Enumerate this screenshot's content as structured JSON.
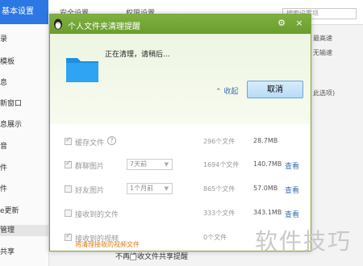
{
  "background": {
    "title": "基本设置",
    "tabs": [
      "安全设置",
      "权限设置"
    ],
    "search_placeholder": "搜索设置项",
    "sidebar": [
      "录",
      "模板",
      "息",
      "新窗口",
      "息展示",
      "音",
      "件",
      "件",
      "e更新",
      "管理",
      "共享"
    ],
    "right_texts": [
      "最高速",
      "无输速",
      "此选项)"
    ],
    "bottom_checkbox_label": "不再接收文件共享提醒"
  },
  "dialog": {
    "title": "个人文件夹清理提醒",
    "status_text": "正在清理，请稍后...",
    "collapse_label": "收起",
    "collapse_arrow": "⌃",
    "cancel_label": "取消",
    "rows": [
      {
        "label": "缓存文件",
        "checked": true,
        "help": "?",
        "select": "",
        "count": "296个文件",
        "size": "28.7MB",
        "view": ""
      },
      {
        "label": "群聊图片",
        "checked": true,
        "help": "",
        "select": "7天前",
        "count": "1694个文件",
        "size": "140.7MB",
        "view": "查看"
      },
      {
        "label": "好友图片",
        "checked": false,
        "help": "",
        "select": "1个月前",
        "count": "865个文件",
        "size": "57.0MB",
        "view": "查看"
      },
      {
        "label": "接收到的文件",
        "checked": false,
        "help": "",
        "select": "",
        "count": "333个文件",
        "size": "343.1MB",
        "view": "查看"
      },
      {
        "label": "接收到的视频",
        "checked": true,
        "help": "",
        "select": "",
        "count": "0个文件",
        "size": "",
        "view": ""
      }
    ],
    "warning_text": "将清理接收的视频文件"
  },
  "watermark": "软件技巧",
  "colors": {
    "titlebar": "#7fb041",
    "accent": "#3a6fb0",
    "warning": "#e07a1d",
    "cancel_bg": "#c9e2f8"
  }
}
